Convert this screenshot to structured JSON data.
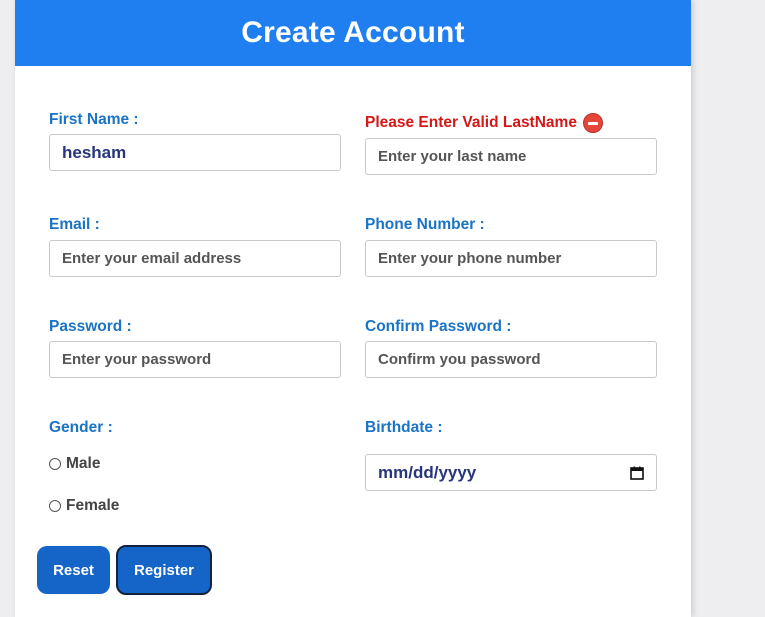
{
  "form": {
    "title": "Create Account",
    "first_name": {
      "label": "First Name :",
      "value": "hesham"
    },
    "last_name": {
      "error_label": "Please Enter Valid LastName",
      "placeholder": "Enter your last name"
    },
    "email": {
      "label": "Email :",
      "placeholder": "Enter your email address"
    },
    "phone": {
      "label": "Phone Number :",
      "placeholder": "Enter your phone number"
    },
    "password": {
      "label": "Password :",
      "placeholder": "Enter your password"
    },
    "confirm_password": {
      "label": "Confirm Password :",
      "placeholder": "Confirm you password"
    },
    "gender": {
      "label": "Gender :",
      "options": [
        "Male",
        "Female"
      ]
    },
    "birthdate": {
      "label": "Birthdate :",
      "placeholder": "mm/dd/yyyy"
    },
    "buttons": {
      "reset": "Reset",
      "register": "Register"
    }
  },
  "colors": {
    "header": "#1f7ef0",
    "label": "#1a73c4",
    "error": "#d31818",
    "button": "#1565c8"
  }
}
